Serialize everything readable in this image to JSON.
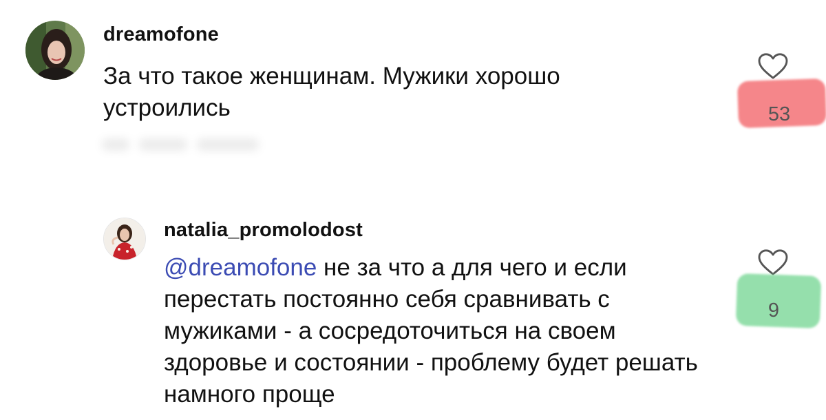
{
  "comments": [
    {
      "username": "dreamofone",
      "text": "За что такое женщинам. Мужики хорошо устроились",
      "likes": "53",
      "highlight_color": "#f4767a",
      "avatar": "avatar-woman-dark-hair"
    },
    {
      "username": "natalia_promolodost",
      "mention": "@dreamofone",
      "text": " не за что а для чего и если перестать постоянно себя сравнивать с мужиками - а сосредоточиться на своем здоровье и состоянии - проблему будет решать намного проще",
      "likes": "9",
      "highlight_color": "#7ed99a",
      "avatar": "avatar-woman-red-dress"
    }
  ],
  "colors": {
    "mention": "#3b4bb3",
    "text": "#111111",
    "heart_outline": "#555555"
  },
  "icons": {
    "like": "heart-outline-icon"
  }
}
